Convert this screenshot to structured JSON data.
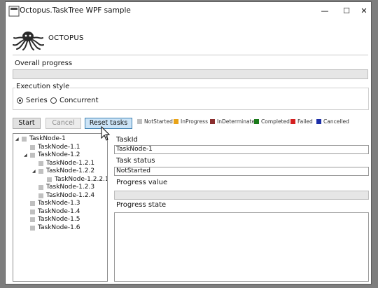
{
  "window": {
    "title": "Octopus.TaskTree WPF sample",
    "controls": {
      "minimize": "—",
      "maximize": "☐",
      "close": "✕"
    }
  },
  "header": {
    "app_name": "OCTOPUS"
  },
  "overall": {
    "label": "Overall progress",
    "progress": 0
  },
  "execution": {
    "label": "Execution style",
    "options": [
      {
        "label": "Series",
        "selected": true
      },
      {
        "label": "Concurrent",
        "selected": false
      }
    ]
  },
  "buttons": {
    "start": "Start",
    "cancel": "Cancel",
    "reset": "Reset tasks"
  },
  "legend": [
    {
      "label": "NotStarted",
      "color": "#c0c0c0"
    },
    {
      "label": "InProgress",
      "color": "#e8a317"
    },
    {
      "label": "InDeterminate",
      "color": "#8b2e2e"
    },
    {
      "label": "Completed",
      "color": "#1a7a1a"
    },
    {
      "label": "Failed",
      "color": "#d42020"
    },
    {
      "label": "Cancelled",
      "color": "#1c2fa8"
    }
  ],
  "tree": [
    {
      "label": "TaskNode-1",
      "level": 0,
      "expanded": true
    },
    {
      "label": "TaskNode-1.1",
      "level": 1,
      "expanded": null
    },
    {
      "label": "TaskNode-1.2",
      "level": 1,
      "expanded": true
    },
    {
      "label": "TaskNode-1.2.1",
      "level": 2,
      "expanded": null
    },
    {
      "label": "TaskNode-1.2.2",
      "level": 2,
      "expanded": true
    },
    {
      "label": "TaskNode-1.2.2.1",
      "level": 3,
      "expanded": null
    },
    {
      "label": "TaskNode-1.2.3",
      "level": 2,
      "expanded": null
    },
    {
      "label": "TaskNode-1.2.4",
      "level": 2,
      "expanded": null
    },
    {
      "label": "TaskNode-1.3",
      "level": 1,
      "expanded": null
    },
    {
      "label": "TaskNode-1.4",
      "level": 1,
      "expanded": null
    },
    {
      "label": "TaskNode-1.5",
      "level": 1,
      "expanded": null
    },
    {
      "label": "TaskNode-1.6",
      "level": 1,
      "expanded": null
    }
  ],
  "details": {
    "task_id_label": "TaskId",
    "task_id_value": "TaskNode-1",
    "status_label": "Task status",
    "status_value": "NotStarted",
    "progress_label": "Progress value",
    "progress_value": 0,
    "state_label": "Progress state",
    "state_value": ""
  }
}
